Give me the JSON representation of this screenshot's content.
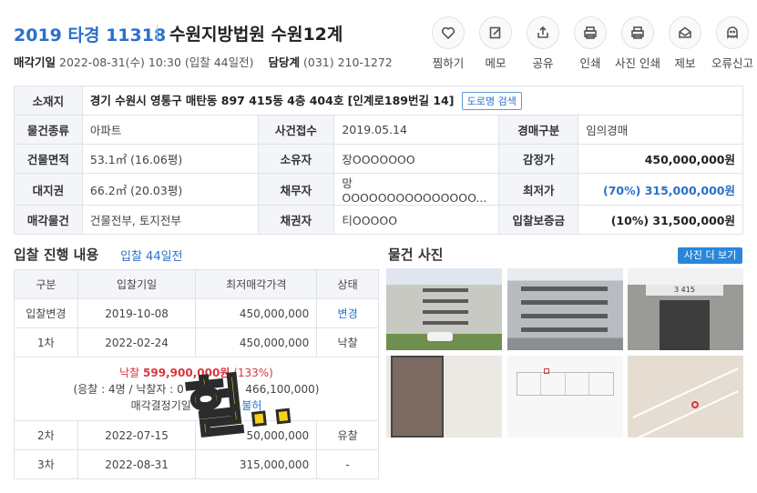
{
  "header": {
    "case_no": "2019 타경 11318",
    "court": "수원지방법원 수원12계",
    "sale_date_label": "매각기일",
    "sale_date": "2022-08-31(수) 10:30 (입찰 44일전)",
    "manager_label": "담당계",
    "manager_phone": "(031) 210-1272"
  },
  "actions": [
    {
      "label": "찜하기",
      "icon": "heart-icon"
    },
    {
      "label": "메모",
      "icon": "memo-icon"
    },
    {
      "label": "공유",
      "icon": "share-icon"
    },
    {
      "label": "인쇄",
      "icon": "print-icon"
    },
    {
      "label": "사진 인쇄",
      "icon": "photo-print-icon"
    },
    {
      "label": "제보",
      "icon": "report-icon"
    },
    {
      "label": "오류신고",
      "icon": "error-icon"
    }
  ],
  "info": {
    "address_label": "소재지",
    "address": "경기 수원시 영통구 매탄동 897 415동 4층 404호 [인계로189번길 14]",
    "road_search": "도로명 검색",
    "type_label": "물건종류",
    "type": "아파트",
    "filed_label": "사건접수",
    "filed": "2019.05.14",
    "auction_type_label": "경매구분",
    "auction_type": "임의경매",
    "area_label": "건물면적",
    "area": "53.1㎡ (16.06평)",
    "owner_label": "소유자",
    "owner": "장OOOOOOO",
    "appraisal_label": "감정가",
    "appraisal": "450,000,000원",
    "land_label": "대지권",
    "land": "66.2㎡ (20.03평)",
    "debtor_label": "채무자",
    "debtor": "망OOOOOOOOOOOOOOO...",
    "min_label": "최저가",
    "min_price": "(70%) 315,000,000원",
    "sale_item_label": "매각물건",
    "sale_item": "건물전부, 토지전부",
    "creditor_label": "채권자",
    "creditor": "티OOOOO",
    "deposit_label": "입찰보증금",
    "deposit": "(10%) 31,500,000원"
  },
  "bidding": {
    "title": "입찰 진행 내용",
    "subtitle": "입찰 44일전",
    "headers": [
      "구분",
      "입찰기일",
      "최저매각가격",
      "상태"
    ],
    "rows": [
      {
        "round": "입찰변경",
        "date": "2019-10-08",
        "price": "450,000,000",
        "status": "변경"
      },
      {
        "round": "1차",
        "date": "2022-02-24",
        "price": "450,000,000",
        "status": "낙찰"
      },
      {
        "round": "2차",
        "date": "2022-07-15",
        "price": "50,000,000",
        "status": "유찰"
      },
      {
        "round": "3차",
        "date": "2022-08-31",
        "price": "315,000,000",
        "status": "-"
      }
    ],
    "detail": {
      "result_label": "낙찰",
      "result_price": "599,900,000원",
      "result_rate": "(133%)",
      "bidders_prefix": "(응찰 : 4명 / 낙찰자 : 0",
      "second_bid": "466,100,000)",
      "decision_prefix": "매각결정기일 :",
      "decision_status": "불허"
    }
  },
  "photos": {
    "title": "물건 사진",
    "more": "사진 더 보기",
    "sign_text": "3 415"
  },
  "sticker": "헐.."
}
